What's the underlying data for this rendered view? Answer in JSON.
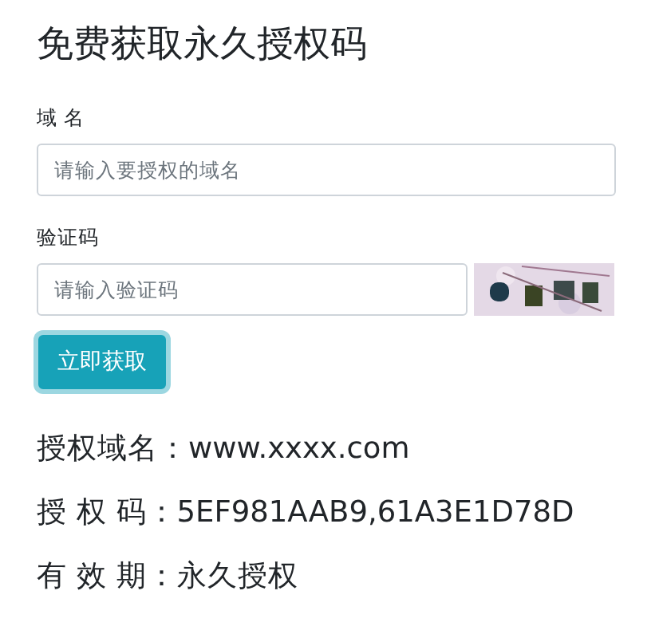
{
  "title": "免费获取永久授权码",
  "domain_field": {
    "label": "域 名",
    "placeholder": "请输入要授权的域名"
  },
  "captcha_field": {
    "label": "验证码",
    "placeholder": "请输入验证码"
  },
  "submit_button": {
    "label": "立即获取"
  },
  "results": [
    "授权域名：www.xxxx.com",
    "授 权 码：5EF981AAB9,61A3E1D78D",
    "有 效 期：永久授权"
  ]
}
